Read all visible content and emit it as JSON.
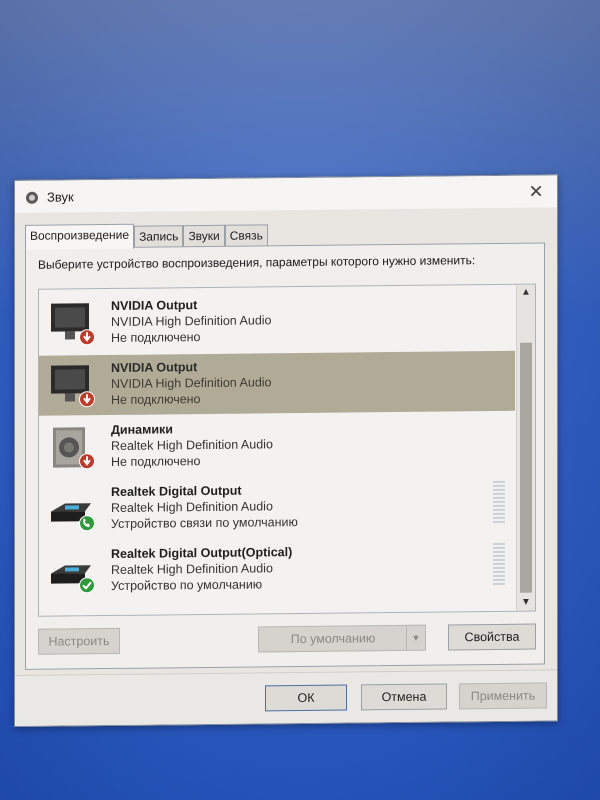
{
  "window": {
    "title": "Звук",
    "close_glyph": "✕"
  },
  "tabs": [
    {
      "label": "Воспроизведение",
      "active": true
    },
    {
      "label": "Запись",
      "active": false
    },
    {
      "label": "Звуки",
      "active": false
    },
    {
      "label": "Связь",
      "active": false
    }
  ],
  "instruction": "Выберите устройство воспроизведения, параметры которого нужно изменить:",
  "devices": [
    {
      "name": "NVIDIA Output",
      "description": "NVIDIA High Definition Audio",
      "status": "Не подключено",
      "icon": "monitor-disconnected-icon",
      "selected": false
    },
    {
      "name": "NVIDIA Output",
      "description": "NVIDIA High Definition Audio",
      "status": "Не подключено",
      "icon": "monitor-disconnected-icon",
      "selected": true
    },
    {
      "name": "Динамики",
      "description": "Realtek High Definition Audio",
      "status": "Не подключено",
      "icon": "speaker-disconnected-icon",
      "selected": false
    },
    {
      "name": "Realtek Digital Output",
      "description": "Realtek High Definition Audio",
      "status": "Устройство связи по умолчанию",
      "icon": "digital-output-phone-icon",
      "selected": false
    },
    {
      "name": "Realtek Digital Output(Optical)",
      "description": "Realtek High Definition Audio",
      "status": "Устройство по умолчанию",
      "icon": "digital-output-default-icon",
      "selected": false
    }
  ],
  "buttons": {
    "configure": "Настроить",
    "set_default": "По умолчанию",
    "properties": "Свойства",
    "ok": "ОК",
    "cancel": "Отмена",
    "apply": "Применить"
  },
  "colors": {
    "selected_row": "#b0ab96",
    "status_disconnected": "#c0392b",
    "status_default": "#2e9a3a"
  }
}
